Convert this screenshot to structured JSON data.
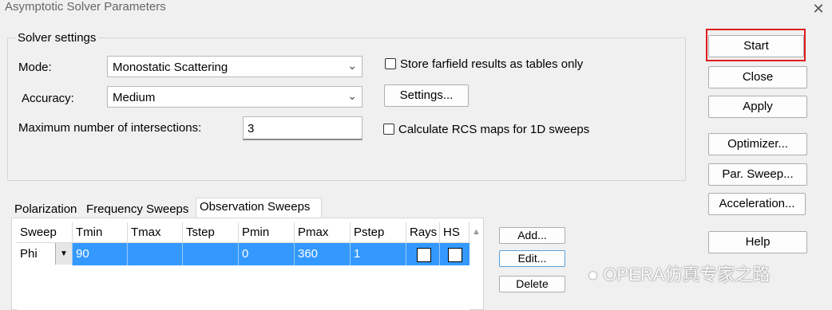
{
  "window": {
    "title": "Asymptotic Solver Parameters",
    "close_glyph": "✕"
  },
  "solver_settings": {
    "legend": "Solver settings",
    "mode_label": "Mode:",
    "mode_value": "Monostatic Scattering",
    "accuracy_label": "Accuracy:",
    "accuracy_value": "Medium",
    "max_intersections_label": "Maximum number of intersections:",
    "max_intersections_value": "3",
    "store_farfield_label": "Store farfield results as tables only",
    "store_farfield_checked": false,
    "settings_button": "Settings...",
    "rcs_maps_label": "Calculate RCS maps for 1D sweeps",
    "rcs_maps_checked": false
  },
  "side_buttons": {
    "start": "Start",
    "close": "Close",
    "apply": "Apply",
    "optimizer": "Optimizer...",
    "par_sweep": "Par. Sweep...",
    "acceleration": "Acceleration...",
    "help": "Help",
    "highlight_color": "#e01b1b"
  },
  "tabs": [
    {
      "label": "Polarization"
    },
    {
      "label": "Frequency Sweeps"
    },
    {
      "label": "Observation Sweeps",
      "active": true
    }
  ],
  "grid": {
    "columns": [
      "Sweep",
      "Tmin",
      "Tmax",
      "Tstep",
      "Pmin",
      "Pmax",
      "Pstep",
      "Rays",
      "HS"
    ],
    "rows": [
      {
        "Sweep": "Phi",
        "Tmin": "90",
        "Tmax": "",
        "Tstep": "",
        "Pmin": "0",
        "Pmax": "360",
        "Pstep": "1",
        "Rays": false,
        "HS": false
      }
    ],
    "selection_color": "#3399ff"
  },
  "grid_buttons": {
    "add": "Add...",
    "edit": "Edit...",
    "delete": "Delete"
  },
  "watermark": {
    "text": "OPERA仿真专家之路"
  }
}
